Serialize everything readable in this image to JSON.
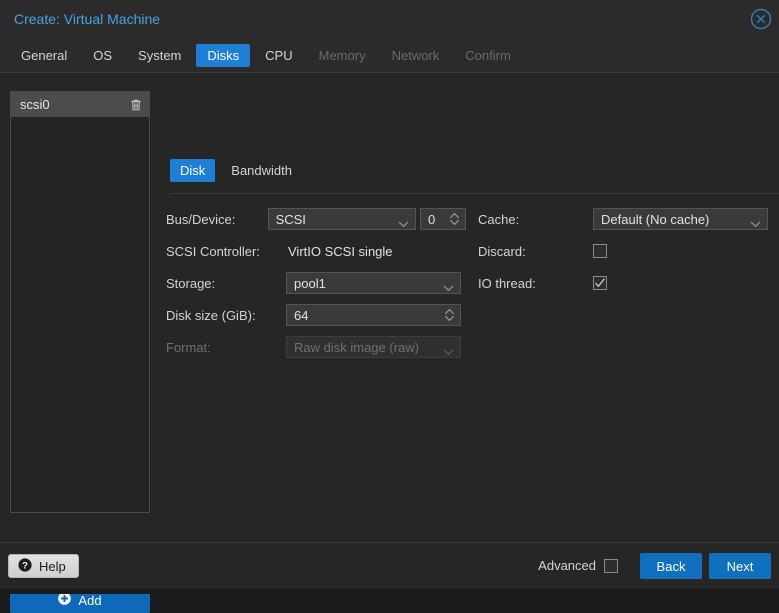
{
  "dialog": {
    "title": "Create: Virtual Machine",
    "close_icon": "close-circle-icon"
  },
  "tabs": [
    {
      "label": "General",
      "state": "normal"
    },
    {
      "label": "OS",
      "state": "normal"
    },
    {
      "label": "System",
      "state": "normal"
    },
    {
      "label": "Disks",
      "state": "active"
    },
    {
      "label": "CPU",
      "state": "normal"
    },
    {
      "label": "Memory",
      "state": "disabled"
    },
    {
      "label": "Network",
      "state": "disabled"
    },
    {
      "label": "Confirm",
      "state": "disabled"
    }
  ],
  "device_list": {
    "items": [
      {
        "label": "scsi0",
        "delete_icon": "trash-icon"
      }
    ],
    "add_label": "Add",
    "add_icon": "plus-circle-icon"
  },
  "subtabs": [
    {
      "label": "Disk",
      "state": "active"
    },
    {
      "label": "Bandwidth",
      "state": "normal"
    }
  ],
  "form": {
    "left": {
      "bus_device": {
        "label": "Bus/Device:",
        "bus_value": "SCSI",
        "device_number": "0"
      },
      "scsi_controller": {
        "label": "SCSI Controller:",
        "value": "VirtIO SCSI single"
      },
      "storage": {
        "label": "Storage:",
        "value": "pool1"
      },
      "disk_size": {
        "label": "Disk size (GiB):",
        "value": "64"
      },
      "format": {
        "label": "Format:",
        "value": "Raw disk image (raw)",
        "disabled": true
      }
    },
    "right": {
      "cache": {
        "label": "Cache:",
        "value": "Default (No cache)"
      },
      "discard": {
        "label": "Discard:",
        "checked": false
      },
      "io_thread": {
        "label": "IO thread:",
        "checked": true
      }
    }
  },
  "footer": {
    "help_label": "Help",
    "help_icon": "question-circle-icon",
    "advanced_label": "Advanced",
    "advanced_checked": false,
    "back_label": "Back",
    "next_label": "Next"
  },
  "colors": {
    "accent_blue": "#1f7fd4",
    "button_blue": "#1070bd",
    "title_blue": "#4aa3e0",
    "dialog_bg": "#262626",
    "header_bg": "#2b2b2b"
  }
}
